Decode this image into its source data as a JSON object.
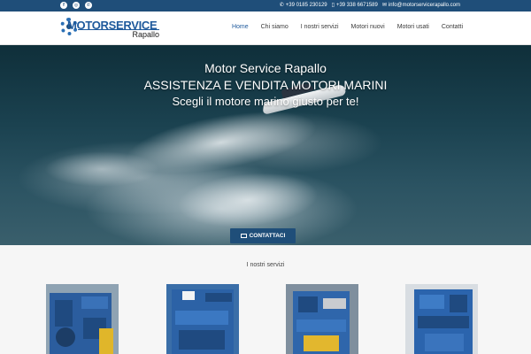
{
  "topbar": {
    "social": [
      "facebook-icon",
      "instagram-icon",
      "whatsapp-icon"
    ],
    "phone1": "+39 0185 230129",
    "phone2": "+39 338 6671589",
    "email": "info@motorservicerapallo.com"
  },
  "logo": {
    "brand": "MOTORSERVICE",
    "sub": "Rapallo"
  },
  "menu": {
    "items": [
      "Home",
      "Chi siamo",
      "I nostri servizi",
      "Motori nuovi",
      "Motori usati",
      "Contatti"
    ],
    "active": "Home"
  },
  "hero": {
    "line1": "Motor Service Rapallo",
    "line2": "ASSISTENZA E VENDITA MOTORI MARINI",
    "line3": "Scegli il motore marino giusto per te!",
    "cta": "CONTATTACI"
  },
  "services": {
    "title": "I nostri servizi"
  },
  "colors": {
    "primary": "#1f4e79",
    "accent": "#1f5a9c",
    "services_bg": "#f6f6f6"
  }
}
